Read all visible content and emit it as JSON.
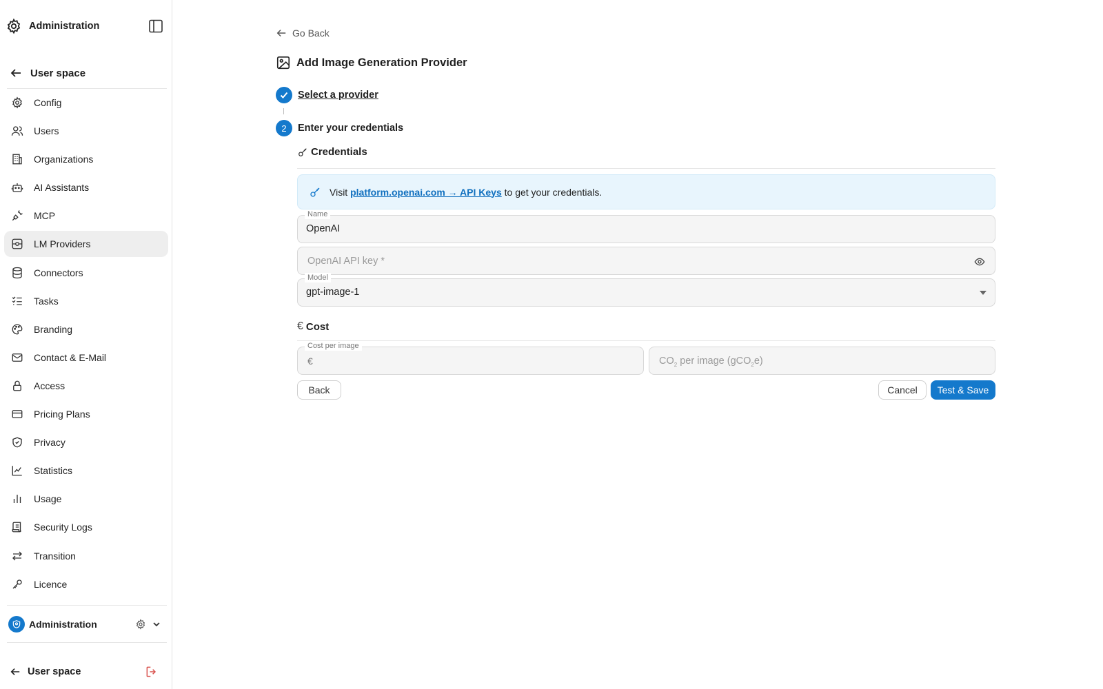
{
  "sidebar": {
    "header_title": "Administration",
    "back_label": "User space",
    "items": [
      {
        "label": "Config",
        "icon": "gear-icon"
      },
      {
        "label": "Users",
        "icon": "users-icon"
      },
      {
        "label": "Organizations",
        "icon": "building-icon"
      },
      {
        "label": "AI Assistants",
        "icon": "robot-icon"
      },
      {
        "label": "MCP",
        "icon": "plug-icon"
      },
      {
        "label": "LM Providers",
        "icon": "provider-icon"
      },
      {
        "label": "Connectors",
        "icon": "database-icon"
      },
      {
        "label": "Tasks",
        "icon": "checklist-icon"
      },
      {
        "label": "Branding",
        "icon": "palette-icon"
      },
      {
        "label": "Contact & E-Mail",
        "icon": "mail-icon"
      },
      {
        "label": "Access",
        "icon": "lock-icon"
      },
      {
        "label": "Pricing Plans",
        "icon": "credit-card-icon"
      },
      {
        "label": "Privacy",
        "icon": "shield-icon"
      },
      {
        "label": "Statistics",
        "icon": "chart-icon"
      },
      {
        "label": "Usage",
        "icon": "bar-chart-icon"
      },
      {
        "label": "Security Logs",
        "icon": "scroll-icon"
      },
      {
        "label": "Transition",
        "icon": "arrows-icon"
      },
      {
        "label": "Licence",
        "icon": "key-icon"
      }
    ],
    "active_item": "LM Providers",
    "org_label": "Administration",
    "footer_label": "User space"
  },
  "main": {
    "go_back": "Go Back",
    "title": "Add Image Generation Provider",
    "step1_label": "Select a provider",
    "step2_number": "2",
    "step2_label": "Enter your credentials",
    "credentials_heading": "Credentials",
    "info_prefix": "Visit",
    "info_link": "platform.openai.com → API Keys",
    "info_suffix": "to get your credentials.",
    "name_label": "Name",
    "name_value": "OpenAI",
    "api_key_placeholder": "OpenAI API key *",
    "model_label": "Model",
    "model_value": "gpt-image-1",
    "cost_heading": "Cost",
    "cost_per_image_label": "Cost per image",
    "currency_symbol": "€",
    "co2_placeholder_prefix": "CO",
    "co2_placeholder_sub": "2",
    "co2_placeholder_mid": " per image (gCO",
    "co2_placeholder_sub2": "2",
    "co2_placeholder_suffix": "e)",
    "back_button": "Back",
    "cancel_button": "Cancel",
    "save_button": "Test & Save"
  },
  "colors": {
    "accent": "#1479cc",
    "info_bg": "#e8f5fd",
    "logout": "#d9534f"
  }
}
